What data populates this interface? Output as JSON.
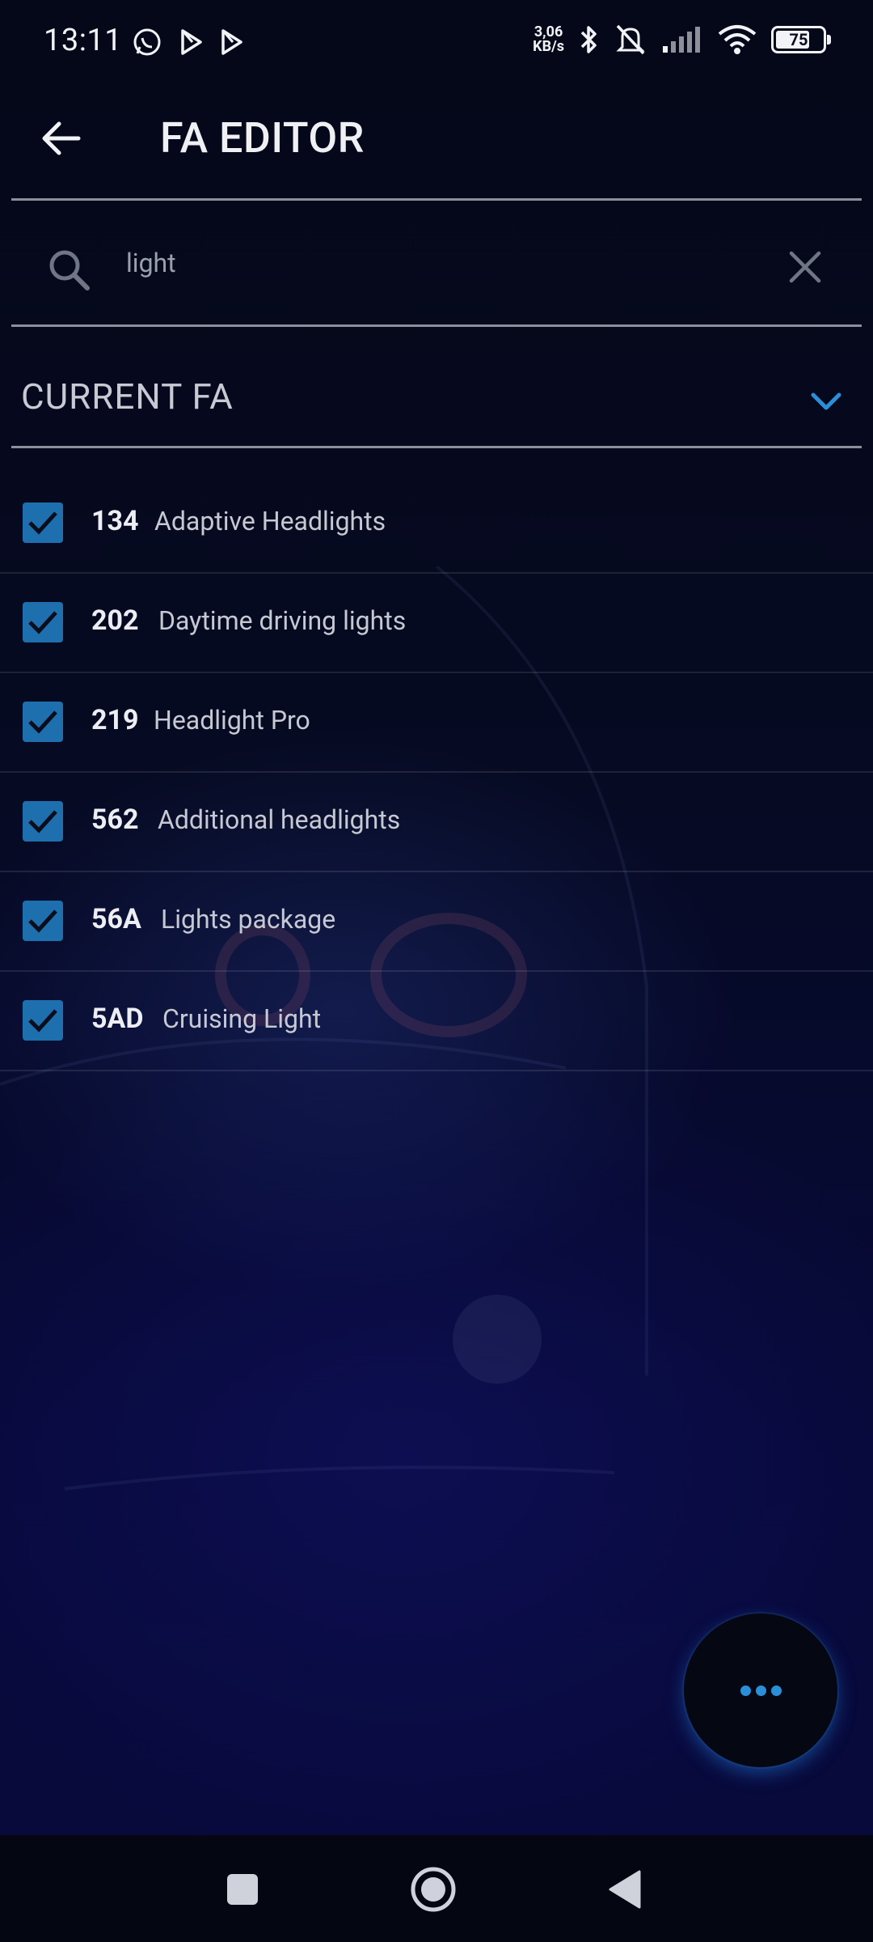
{
  "status_bar": {
    "time": "13:11",
    "net_speed_value": "3,06",
    "net_speed_unit": "KB/s",
    "battery": "75",
    "battery_level": 75
  },
  "app_bar": {
    "title": "FA EDITOR"
  },
  "search": {
    "query": "light"
  },
  "section": {
    "title": "CURRENT FA"
  },
  "items": [
    {
      "code": "134",
      "name": "Adaptive Headlights",
      "checked": true
    },
    {
      "code": "202",
      "name": "Daytime driving lights",
      "checked": true
    },
    {
      "code": "219",
      "name": "Headlight Pro",
      "checked": true
    },
    {
      "code": "562",
      "name": "Additional headlights",
      "checked": true
    },
    {
      "code": "56A",
      "name": "Lights package",
      "checked": true
    },
    {
      "code": "5AD",
      "name": "Cruising Light",
      "checked": true
    }
  ],
  "colors": {
    "accent": "#1e6fae",
    "fab_dots": "#2b8fd8",
    "background": "#05081a"
  }
}
